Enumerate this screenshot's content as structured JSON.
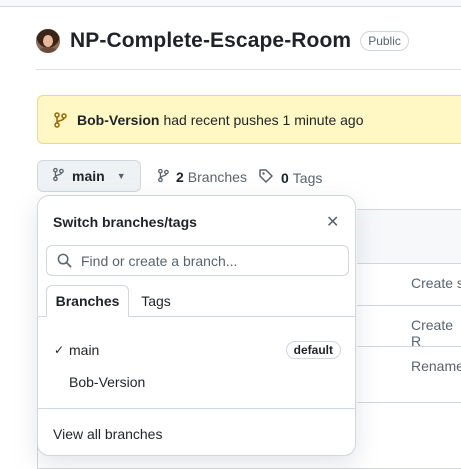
{
  "repo": {
    "name": "NP-Complete-Escape-Room",
    "visibility": "Public"
  },
  "banner": {
    "branch": "Bob-Version",
    "message": "had recent pushes 1 minute ago"
  },
  "toolbar": {
    "current_branch": "main",
    "branches_count": "2",
    "branches_label": "Branches",
    "tags_count": "0",
    "tags_label": "Tags"
  },
  "background_rows": [
    "Create s",
    "Create R",
    "Rename"
  ],
  "dropdown": {
    "title": "Switch branches/tags",
    "search_placeholder": "Find or create a branch...",
    "tabs": [
      "Branches",
      "Tags"
    ],
    "branches": [
      {
        "name": "main",
        "checked": true,
        "badge": "default"
      },
      {
        "name": "Bob-Version",
        "checked": false,
        "badge": ""
      }
    ],
    "check_glyph": "✓",
    "close_glyph": "✕",
    "footer_link": "View all branches"
  },
  "colors": {
    "banner_bg": "#fff8c5",
    "banner_icon": "#9a6700",
    "text": "#1f2328",
    "muted": "#59636e",
    "border": "#d0d7de"
  },
  "icons": {
    "branch": "git-branch-icon",
    "tag": "tag-icon",
    "search": "search-icon",
    "close": "close-icon",
    "check": "check-icon",
    "caret": "triangle-down-icon"
  }
}
